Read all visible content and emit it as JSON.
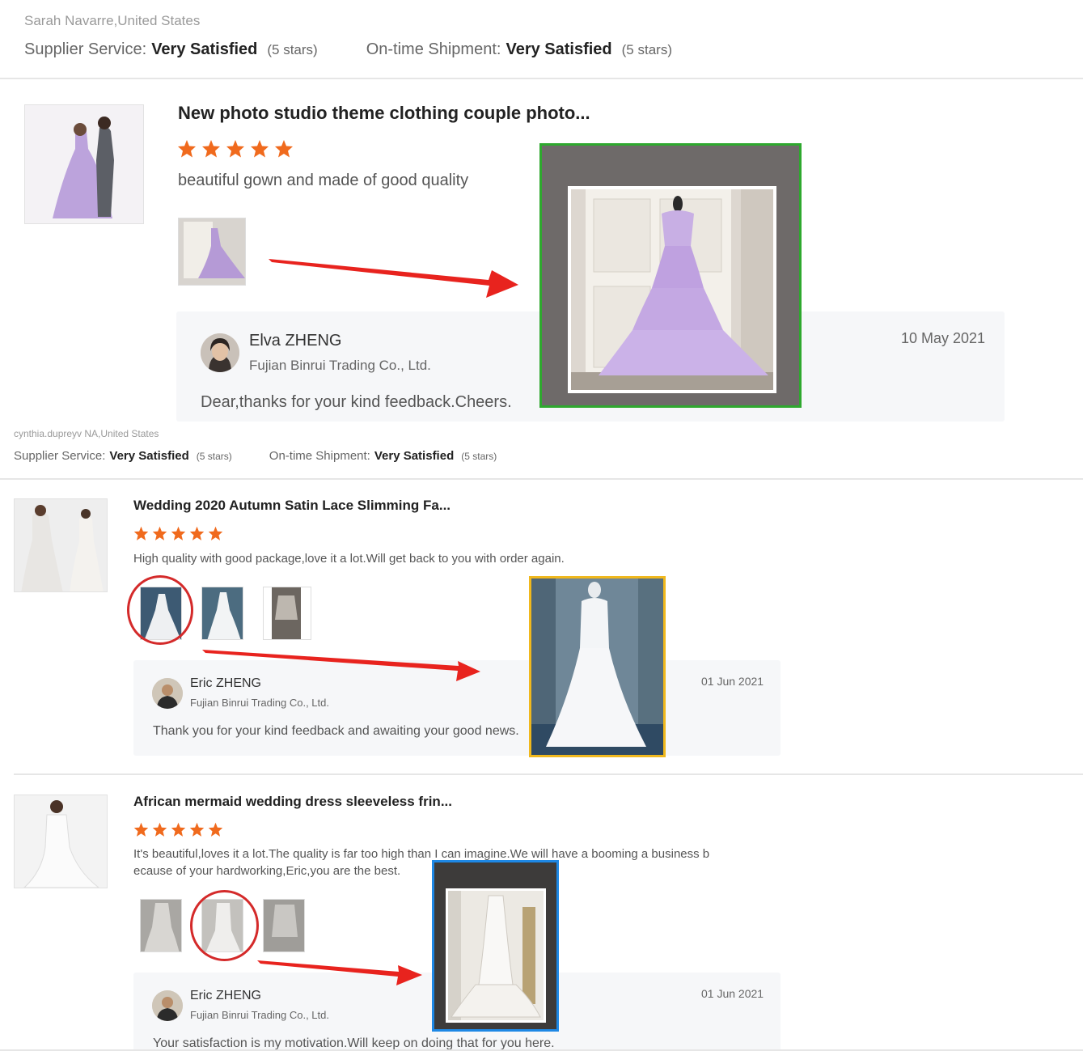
{
  "reviews": [
    {
      "reviewer": "Sarah Navarre,United States",
      "supplier_service_label": "Supplier Service:",
      "supplier_service_value": "Very Satisfied",
      "supplier_service_stars": "(5 stars)",
      "shipment_label": "On-time Shipment:",
      "shipment_value": "Very Satisfied",
      "shipment_stars": "(5 stars)",
      "product_title": "New photo studio theme clothing couple photo...",
      "rating": 5,
      "text": "beautiful gown and made of good quality",
      "reply": {
        "name": "Elva ZHENG",
        "company": "Fujian Binrui Trading Co., Ltd.",
        "date": "10 May 2021",
        "text": "Dear,thanks for your kind feedback.Cheers."
      }
    },
    {
      "reviewer": "cynthia.dupreyv NA,United States",
      "supplier_service_label": "Supplier Service:",
      "supplier_service_value": "Very Satisfied",
      "supplier_service_stars": "(5 stars)",
      "shipment_label": "On-time Shipment:",
      "shipment_value": "Very Satisfied",
      "shipment_stars": "(5 stars)",
      "product_title": "Wedding 2020 Autumn Satin Lace Slimming Fa...",
      "rating": 5,
      "text": "High quality with good package,love it a lot.Will get back to you with order again.",
      "reply": {
        "name": "Eric ZHENG",
        "company": "Fujian Binrui Trading Co., Ltd.",
        "date": "01 Jun 2021",
        "text": "Thank you for your kind feedback and awaiting your good news."
      }
    },
    {
      "product_title": "African mermaid wedding dress sleeveless frin...",
      "rating": 5,
      "text_line1": "It's beautiful,loves it a lot.The quality is far too high than I can imagine.We will have a booming a business b",
      "text_line2": "ecause of your hardworking,Eric,you are the best.",
      "reply": {
        "name": "Eric ZHENG",
        "company": "Fujian Binrui Trading Co., Ltd.",
        "date": "01 Jun 2021",
        "text": "Your satisfaction is my motivation.Will keep on doing that for you here."
      }
    }
  ],
  "colors": {
    "star": "#f06a1d",
    "arrow": "#e8231e",
    "highlight_green": "#2ea82e",
    "highlight_yellow": "#f0b81d",
    "highlight_blue": "#1e88e5",
    "circle": "#d42a2a"
  },
  "icons": [
    "star-icon",
    "avatar",
    "dress-photo",
    "arrow-annotation",
    "circle-annotation"
  ]
}
